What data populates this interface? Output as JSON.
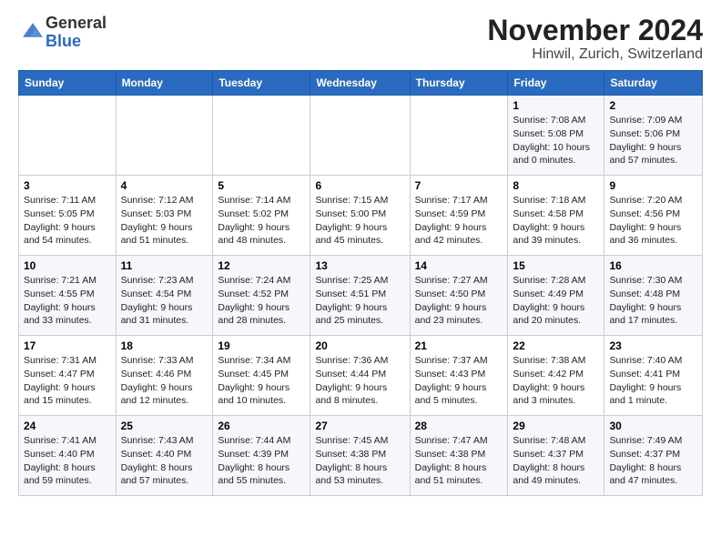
{
  "logo": {
    "general": "General",
    "blue": "Blue"
  },
  "title": "November 2024",
  "subtitle": "Hinwil, Zurich, Switzerland",
  "weekdays": [
    "Sunday",
    "Monday",
    "Tuesday",
    "Wednesday",
    "Thursday",
    "Friday",
    "Saturday"
  ],
  "weeks": [
    [
      {
        "day": "",
        "info": ""
      },
      {
        "day": "",
        "info": ""
      },
      {
        "day": "",
        "info": ""
      },
      {
        "day": "",
        "info": ""
      },
      {
        "day": "",
        "info": ""
      },
      {
        "day": "1",
        "info": "Sunrise: 7:08 AM\nSunset: 5:08 PM\nDaylight: 10 hours\nand 0 minutes."
      },
      {
        "day": "2",
        "info": "Sunrise: 7:09 AM\nSunset: 5:06 PM\nDaylight: 9 hours\nand 57 minutes."
      }
    ],
    [
      {
        "day": "3",
        "info": "Sunrise: 7:11 AM\nSunset: 5:05 PM\nDaylight: 9 hours\nand 54 minutes."
      },
      {
        "day": "4",
        "info": "Sunrise: 7:12 AM\nSunset: 5:03 PM\nDaylight: 9 hours\nand 51 minutes."
      },
      {
        "day": "5",
        "info": "Sunrise: 7:14 AM\nSunset: 5:02 PM\nDaylight: 9 hours\nand 48 minutes."
      },
      {
        "day": "6",
        "info": "Sunrise: 7:15 AM\nSunset: 5:00 PM\nDaylight: 9 hours\nand 45 minutes."
      },
      {
        "day": "7",
        "info": "Sunrise: 7:17 AM\nSunset: 4:59 PM\nDaylight: 9 hours\nand 42 minutes."
      },
      {
        "day": "8",
        "info": "Sunrise: 7:18 AM\nSunset: 4:58 PM\nDaylight: 9 hours\nand 39 minutes."
      },
      {
        "day": "9",
        "info": "Sunrise: 7:20 AM\nSunset: 4:56 PM\nDaylight: 9 hours\nand 36 minutes."
      }
    ],
    [
      {
        "day": "10",
        "info": "Sunrise: 7:21 AM\nSunset: 4:55 PM\nDaylight: 9 hours\nand 33 minutes."
      },
      {
        "day": "11",
        "info": "Sunrise: 7:23 AM\nSunset: 4:54 PM\nDaylight: 9 hours\nand 31 minutes."
      },
      {
        "day": "12",
        "info": "Sunrise: 7:24 AM\nSunset: 4:52 PM\nDaylight: 9 hours\nand 28 minutes."
      },
      {
        "day": "13",
        "info": "Sunrise: 7:25 AM\nSunset: 4:51 PM\nDaylight: 9 hours\nand 25 minutes."
      },
      {
        "day": "14",
        "info": "Sunrise: 7:27 AM\nSunset: 4:50 PM\nDaylight: 9 hours\nand 23 minutes."
      },
      {
        "day": "15",
        "info": "Sunrise: 7:28 AM\nSunset: 4:49 PM\nDaylight: 9 hours\nand 20 minutes."
      },
      {
        "day": "16",
        "info": "Sunrise: 7:30 AM\nSunset: 4:48 PM\nDaylight: 9 hours\nand 17 minutes."
      }
    ],
    [
      {
        "day": "17",
        "info": "Sunrise: 7:31 AM\nSunset: 4:47 PM\nDaylight: 9 hours\nand 15 minutes."
      },
      {
        "day": "18",
        "info": "Sunrise: 7:33 AM\nSunset: 4:46 PM\nDaylight: 9 hours\nand 12 minutes."
      },
      {
        "day": "19",
        "info": "Sunrise: 7:34 AM\nSunset: 4:45 PM\nDaylight: 9 hours\nand 10 minutes."
      },
      {
        "day": "20",
        "info": "Sunrise: 7:36 AM\nSunset: 4:44 PM\nDaylight: 9 hours\nand 8 minutes."
      },
      {
        "day": "21",
        "info": "Sunrise: 7:37 AM\nSunset: 4:43 PM\nDaylight: 9 hours\nand 5 minutes."
      },
      {
        "day": "22",
        "info": "Sunrise: 7:38 AM\nSunset: 4:42 PM\nDaylight: 9 hours\nand 3 minutes."
      },
      {
        "day": "23",
        "info": "Sunrise: 7:40 AM\nSunset: 4:41 PM\nDaylight: 9 hours\nand 1 minute."
      }
    ],
    [
      {
        "day": "24",
        "info": "Sunrise: 7:41 AM\nSunset: 4:40 PM\nDaylight: 8 hours\nand 59 minutes."
      },
      {
        "day": "25",
        "info": "Sunrise: 7:43 AM\nSunset: 4:40 PM\nDaylight: 8 hours\nand 57 minutes."
      },
      {
        "day": "26",
        "info": "Sunrise: 7:44 AM\nSunset: 4:39 PM\nDaylight: 8 hours\nand 55 minutes."
      },
      {
        "day": "27",
        "info": "Sunrise: 7:45 AM\nSunset: 4:38 PM\nDaylight: 8 hours\nand 53 minutes."
      },
      {
        "day": "28",
        "info": "Sunrise: 7:47 AM\nSunset: 4:38 PM\nDaylight: 8 hours\nand 51 minutes."
      },
      {
        "day": "29",
        "info": "Sunrise: 7:48 AM\nSunset: 4:37 PM\nDaylight: 8 hours\nand 49 minutes."
      },
      {
        "day": "30",
        "info": "Sunrise: 7:49 AM\nSunset: 4:37 PM\nDaylight: 8 hours\nand 47 minutes."
      }
    ]
  ]
}
